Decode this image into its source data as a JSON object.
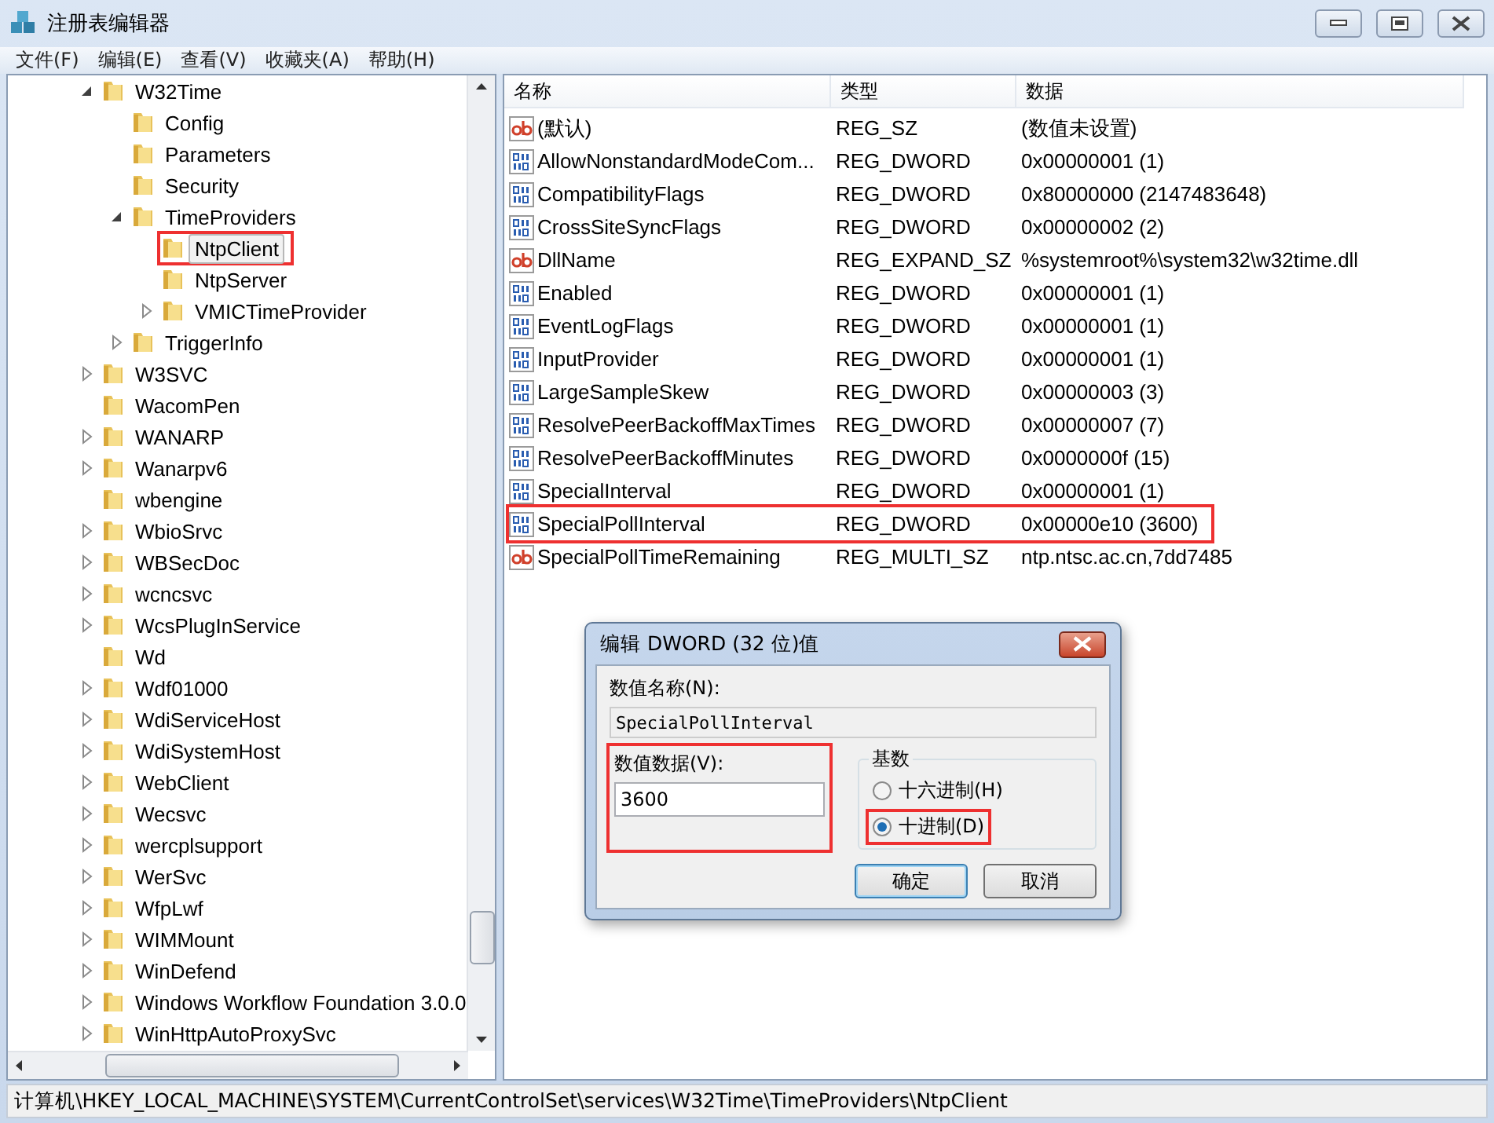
{
  "window": {
    "title": "注册表编辑器"
  },
  "menu": [
    "文件(F)",
    "编辑(E)",
    "查看(V)",
    "收藏夹(A)",
    "帮助(H)"
  ],
  "tree": {
    "items": [
      {
        "label": "W32Time",
        "expandable": true,
        "expanded": true,
        "selected": false,
        "highlighted": false,
        "children": [
          {
            "label": "Config",
            "expandable": false,
            "expanded": false,
            "selected": false,
            "highlighted": false
          },
          {
            "label": "Parameters",
            "expandable": false,
            "expanded": false,
            "selected": false,
            "highlighted": false
          },
          {
            "label": "Security",
            "expandable": false,
            "expanded": false,
            "selected": false,
            "highlighted": false
          },
          {
            "label": "TimeProviders",
            "expandable": true,
            "expanded": true,
            "selected": false,
            "highlighted": false,
            "children": [
              {
                "label": "NtpClient",
                "expandable": false,
                "expanded": false,
                "selected": true,
                "highlighted": true
              },
              {
                "label": "NtpServer",
                "expandable": false,
                "expanded": false,
                "selected": false,
                "highlighted": false
              },
              {
                "label": "VMICTimeProvider",
                "expandable": true,
                "expanded": false,
                "selected": false,
                "highlighted": false
              }
            ]
          },
          {
            "label": "TriggerInfo",
            "expandable": true,
            "expanded": false,
            "selected": false,
            "highlighted": false
          }
        ]
      },
      {
        "label": "W3SVC",
        "expandable": true,
        "expanded": false,
        "selected": false,
        "highlighted": false
      },
      {
        "label": "WacomPen",
        "expandable": false,
        "expanded": false,
        "selected": false,
        "highlighted": false
      },
      {
        "label": "WANARP",
        "expandable": true,
        "expanded": false,
        "selected": false,
        "highlighted": false
      },
      {
        "label": "Wanarpv6",
        "expandable": true,
        "expanded": false,
        "selected": false,
        "highlighted": false
      },
      {
        "label": "wbengine",
        "expandable": false,
        "expanded": false,
        "selected": false,
        "highlighted": false
      },
      {
        "label": "WbioSrvc",
        "expandable": true,
        "expanded": false,
        "selected": false,
        "highlighted": false
      },
      {
        "label": "WBSecDoc",
        "expandable": true,
        "expanded": false,
        "selected": false,
        "highlighted": false
      },
      {
        "label": "wcncsvc",
        "expandable": true,
        "expanded": false,
        "selected": false,
        "highlighted": false
      },
      {
        "label": "WcsPlugInService",
        "expandable": true,
        "expanded": false,
        "selected": false,
        "highlighted": false
      },
      {
        "label": "Wd",
        "expandable": false,
        "expanded": false,
        "selected": false,
        "highlighted": false
      },
      {
        "label": "Wdf01000",
        "expandable": true,
        "expanded": false,
        "selected": false,
        "highlighted": false
      },
      {
        "label": "WdiServiceHost",
        "expandable": true,
        "expanded": false,
        "selected": false,
        "highlighted": false
      },
      {
        "label": "WdiSystemHost",
        "expandable": true,
        "expanded": false,
        "selected": false,
        "highlighted": false
      },
      {
        "label": "WebClient",
        "expandable": true,
        "expanded": false,
        "selected": false,
        "highlighted": false
      },
      {
        "label": "Wecsvc",
        "expandable": true,
        "expanded": false,
        "selected": false,
        "highlighted": false
      },
      {
        "label": "wercplsupport",
        "expandable": true,
        "expanded": false,
        "selected": false,
        "highlighted": false
      },
      {
        "label": "WerSvc",
        "expandable": true,
        "expanded": false,
        "selected": false,
        "highlighted": false
      },
      {
        "label": "WfpLwf",
        "expandable": true,
        "expanded": false,
        "selected": false,
        "highlighted": false
      },
      {
        "label": "WIMMount",
        "expandable": true,
        "expanded": false,
        "selected": false,
        "highlighted": false
      },
      {
        "label": "WinDefend",
        "expandable": true,
        "expanded": false,
        "selected": false,
        "highlighted": false
      },
      {
        "label": "Windows Workflow Foundation 3.0.0",
        "expandable": true,
        "expanded": false,
        "selected": false,
        "highlighted": false
      },
      {
        "label": "WinHttpAutoProxySvc",
        "expandable": true,
        "expanded": false,
        "selected": false,
        "highlighted": false
      }
    ]
  },
  "list": {
    "columns": [
      "名称",
      "类型",
      "数据"
    ],
    "rows": [
      {
        "kind": "string",
        "name": "(默认)",
        "type": "REG_SZ",
        "data": "(数值未设置)",
        "highlighted": false
      },
      {
        "kind": "binary",
        "name": "AllowNonstandardModeCom...",
        "type": "REG_DWORD",
        "data": "0x00000001 (1)",
        "highlighted": false
      },
      {
        "kind": "binary",
        "name": "CompatibilityFlags",
        "type": "REG_DWORD",
        "data": "0x80000000 (2147483648)",
        "highlighted": false
      },
      {
        "kind": "binary",
        "name": "CrossSiteSyncFlags",
        "type": "REG_DWORD",
        "data": "0x00000002 (2)",
        "highlighted": false
      },
      {
        "kind": "string",
        "name": "DllName",
        "type": "REG_EXPAND_SZ",
        "data": "%systemroot%\\system32\\w32time.dll",
        "highlighted": false
      },
      {
        "kind": "binary",
        "name": "Enabled",
        "type": "REG_DWORD",
        "data": "0x00000001 (1)",
        "highlighted": false
      },
      {
        "kind": "binary",
        "name": "EventLogFlags",
        "type": "REG_DWORD",
        "data": "0x00000001 (1)",
        "highlighted": false
      },
      {
        "kind": "binary",
        "name": "InputProvider",
        "type": "REG_DWORD",
        "data": "0x00000001 (1)",
        "highlighted": false
      },
      {
        "kind": "binary",
        "name": "LargeSampleSkew",
        "type": "REG_DWORD",
        "data": "0x00000003 (3)",
        "highlighted": false
      },
      {
        "kind": "binary",
        "name": "ResolvePeerBackoffMaxTimes",
        "type": "REG_DWORD",
        "data": "0x00000007 (7)",
        "highlighted": false
      },
      {
        "kind": "binary",
        "name": "ResolvePeerBackoffMinutes",
        "type": "REG_DWORD",
        "data": "0x0000000f (15)",
        "highlighted": false
      },
      {
        "kind": "binary",
        "name": "SpecialInterval",
        "type": "REG_DWORD",
        "data": "0x00000001 (1)",
        "highlighted": false
      },
      {
        "kind": "binary",
        "name": "SpecialPollInterval",
        "type": "REG_DWORD",
        "data": "0x00000e10 (3600)",
        "highlighted": true
      },
      {
        "kind": "string",
        "name": "SpecialPollTimeRemaining",
        "type": "REG_MULTI_SZ",
        "data": "ntp.ntsc.ac.cn,7dd7485",
        "highlighted": false
      }
    ]
  },
  "status_bar": "计算机\\HKEY_LOCAL_MACHINE\\SYSTEM\\CurrentControlSet\\services\\W32Time\\TimeProviders\\NtpClient",
  "dialog": {
    "title": "编辑 DWORD (32 位)值",
    "name_label": "数值名称(N):",
    "name_value": "SpecialPollInterval",
    "data_label": "数值数据(V):",
    "data_value": "3600",
    "data_highlighted": true,
    "base_label": "基数",
    "base_options": [
      {
        "label": "十六进制(H)",
        "selected": false,
        "highlighted": false
      },
      {
        "label": "十进制(D)",
        "selected": true,
        "highlighted": true
      }
    ],
    "buttons": [
      {
        "label": "确定",
        "default": true
      },
      {
        "label": "取消",
        "default": false
      }
    ]
  }
}
